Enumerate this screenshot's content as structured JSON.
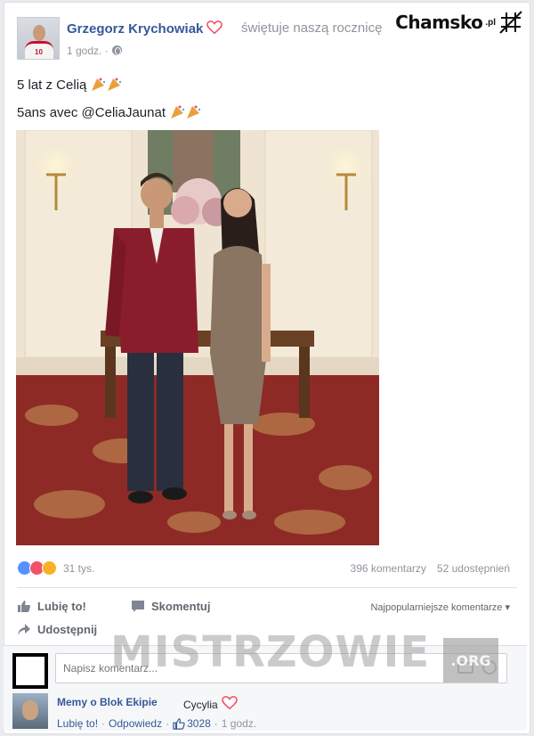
{
  "post": {
    "author": "Grzegorz Krychowiak",
    "action": "świętuje naszą rocznicę",
    "time": "1 godz. ·",
    "line1": "5 lat z Celią",
    "line2": "5ans avec @CeliaJaunat"
  },
  "logo": {
    "name": "Chamsko",
    "suffix": ".pl"
  },
  "stats": {
    "reactions_count": "31 tys.",
    "comments": "396 komentarzy",
    "shares": "52 udostępnień"
  },
  "actions": {
    "like": "Lubię to!",
    "comment": "Skomentuj",
    "share": "Udostępnij",
    "sort": "Najpopularniejsze komentarze ▾"
  },
  "watermark": {
    "text": "MISTRZOWIE",
    "suffix": ".ORG"
  },
  "comment_box": {
    "placeholder": "Napisz komentarz..."
  },
  "reply": {
    "author": "Memy o Blok Ekipie",
    "text": "Cycylia",
    "like": "Lubię to!",
    "respond": "Odpowiedz",
    "likes": "3028",
    "time": "1 godz."
  },
  "colors": {
    "link": "#365899",
    "like_reaction": "#5890ff",
    "love_reaction": "#f25268",
    "wow_reaction": "#f7b125"
  }
}
